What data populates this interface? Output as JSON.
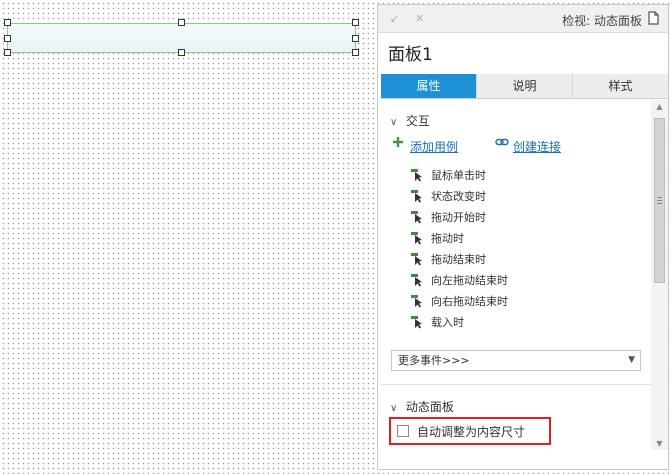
{
  "panel": {
    "title": "检视: 动态面板",
    "name": "面板1",
    "tabs": [
      {
        "label": "属性"
      },
      {
        "label": "说明"
      },
      {
        "label": "样式"
      }
    ]
  },
  "interactions": {
    "section_title": "交互",
    "add_case": "添加用例",
    "create_link": "创建连接",
    "events": [
      {
        "label": "鼠标单击时"
      },
      {
        "label": "状态改变时"
      },
      {
        "label": "拖动开始时"
      },
      {
        "label": "拖动时"
      },
      {
        "label": "拖动结束时"
      },
      {
        "label": "向左拖动结束时"
      },
      {
        "label": "向右拖动结束时"
      },
      {
        "label": "载入时"
      }
    ],
    "more_events": "更多事件>>>"
  },
  "dynamic_panel": {
    "section_title": "动态面板",
    "auto_fit_label": "自动调整为内容尺寸",
    "auto_fit_checked": false
  },
  "colors": {
    "tab_active": "#1e90d6",
    "link": "#1a6fb5",
    "highlight": "#e02020",
    "event_icon": "#3c8c3c"
  }
}
